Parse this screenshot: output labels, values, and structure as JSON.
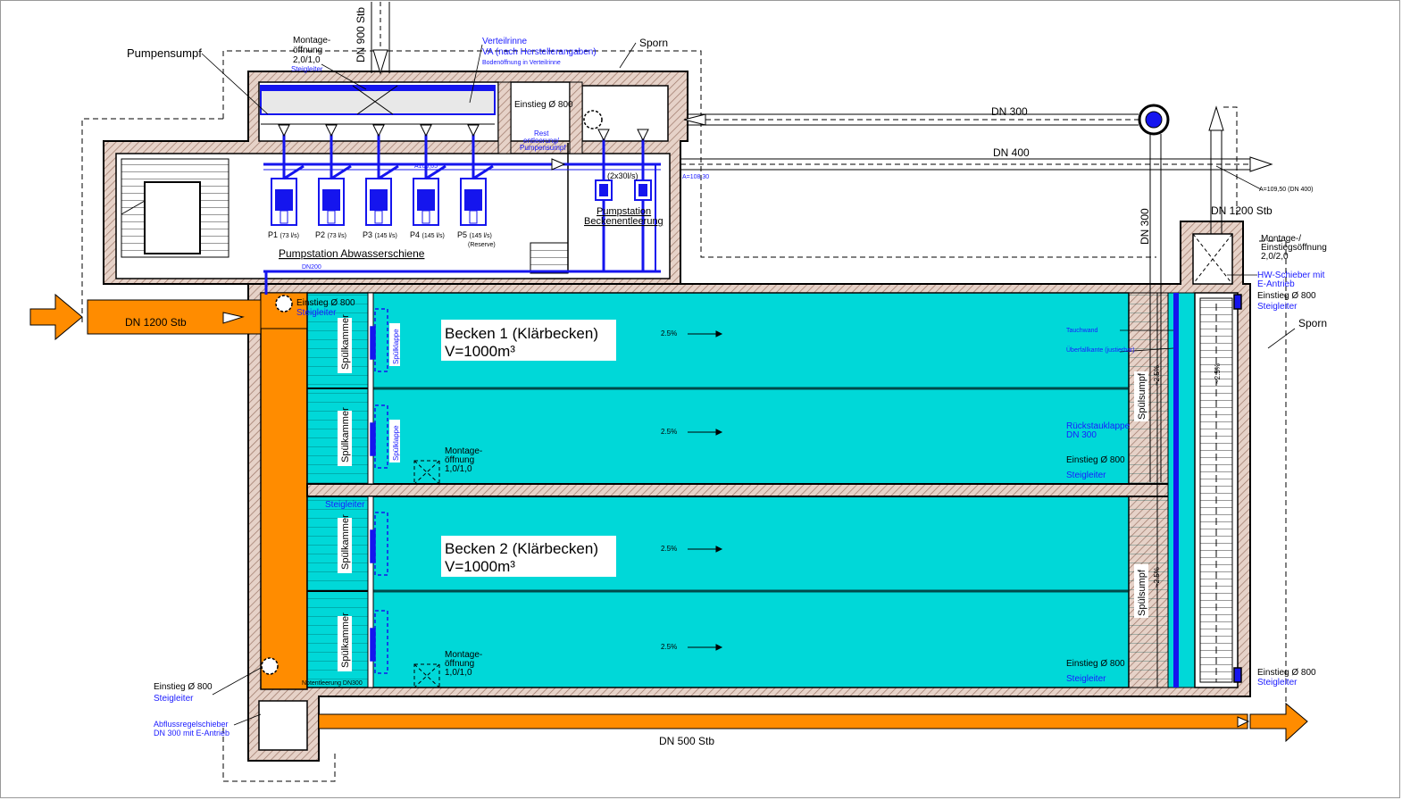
{
  "colors": {
    "basin": "#00d8d8",
    "channel": "#ff8c00",
    "wall_hatch": "#c9a89a",
    "wall_stroke": "#000000",
    "annotation_blue": "#1a1aff",
    "equipment_blue": "#1515ee"
  },
  "labels": {
    "pumpensumpf": "Pumpensumpf",
    "montage_top_1": "Montage-",
    "montage_top_2": "öffnung",
    "montage_top_3": "2,0/1,0",
    "steigleiter_top": "Steigleiter",
    "dn900": "DN 900 Stb",
    "verteilrinne": "Verteilrinne",
    "verteilrinne_va": "VA (nach Herstellerangaben)",
    "bodenoeffnung": "Bodenöffnung in Verteilrinne",
    "sporn_top": "Sporn",
    "einstieg_800_top": "Einstieg Ø 800",
    "rest_1": "Rest",
    "rest_2": "entleerung/",
    "rest_3": "Pumpensumpf",
    "dn300_top": "DN 300",
    "dn400": "DN 400",
    "a_109": "A=109,50 (DN 400)",
    "a_106": "A106,05",
    "a_108": "A=108,30",
    "dn300_vertical": "DN 300",
    "dn1200_right": "DN 1200 Stb",
    "montage_right_1": "Montage-/",
    "montage_right_2": "Einstiegsöffnung",
    "montage_right_3": "2,0/2,0",
    "hw_schieber_1": "HW-Schieber mit",
    "hw_schieber_2": "E-Antrieb",
    "einstieg_right_top": "Einstieg Ø 800",
    "steigleiter_right_top": "Steigleiter",
    "sporn_right": "Sporn",
    "pump_2x30": "(2x30l/s)",
    "pumpstation_b1": "Pumpstation",
    "pumpstation_b2": "Beckenentleerung",
    "pumpstation_abw": "Pumpstation Abwasserschiene",
    "dn200": "DN200",
    "dn1200_left": "DN 1200 Stb",
    "einstieg_left_top": "Einstieg Ø 800",
    "steigleiter_left_top": "Steigleiter",
    "becken1_title": "Becken 1 (Klärbecken)",
    "becken1_volume": "V=1000m³",
    "becken2_title": "Becken 2 (Klärbecken)",
    "becken2_volume": "V=1000m³",
    "slope": "2.5%",
    "slope_vertical": "~2.5%",
    "spuelkammer": "Spülkammer",
    "spuelklappe": "Spülklappe",
    "spuelsumpf": "Spülsumpf",
    "montage_mid_1": "Montage-",
    "montage_mid_2": "öffnung",
    "montage_mid_3": "1,0/1,0",
    "steigleiter_mid": "Steigleiter",
    "tauchwand": "Tauchwand",
    "ueberfallkante": "Überfallkante (justierbar)",
    "rueckstau_1": "Rückstauklappe",
    "rueckstau_2": "DN 300",
    "einstieg_mid_right": "Einstieg Ø 800",
    "steigleiter_mid_right": "Steigleiter",
    "einstieg_bot_right": "Einstieg Ø 800",
    "steigleiter_bot_right": "Steigleiter",
    "einstieg_far_right": "Einstieg Ø 800",
    "steigleiter_far_right": "Steigleiter",
    "einstieg_bot_left": "Einstieg Ø 800",
    "steigleiter_bot_left": "Steigleiter",
    "abfluss_1": "Abflussregelschieber",
    "abfluss_2": "DN 300 mit E-Antrieb",
    "notentleerung": "Notentleerung DN300",
    "dn500": "DN 500 Stb"
  },
  "pumps": [
    {
      "name": "P1",
      "flow": "(73 l/s)"
    },
    {
      "name": "P2",
      "flow": "(73 l/s)"
    },
    {
      "name": "P3",
      "flow": "(145 l/s)"
    },
    {
      "name": "P4",
      "flow": "(145 l/s)"
    },
    {
      "name": "P5",
      "flow": "(145 l/s)",
      "note": "(Reserve)"
    }
  ]
}
